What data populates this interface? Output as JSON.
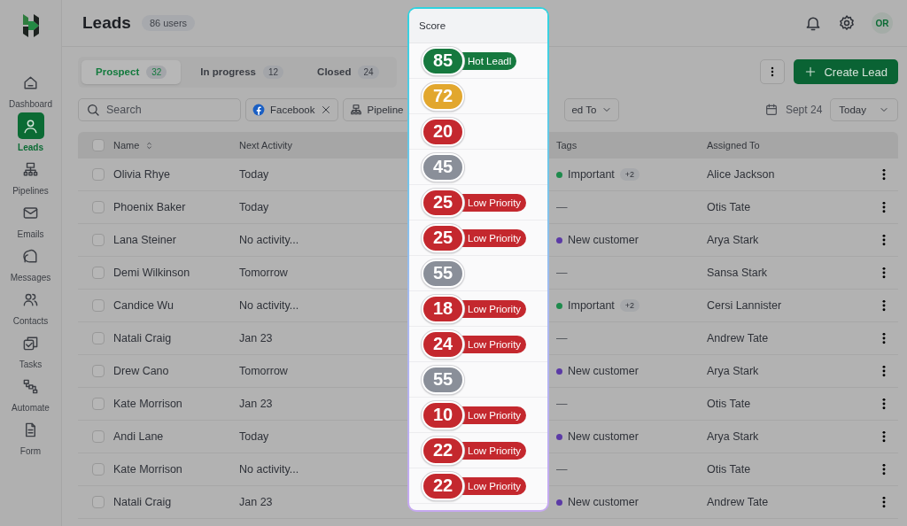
{
  "sidebar": {
    "items": [
      {
        "label": "Dashboard",
        "selected": false
      },
      {
        "label": "Leads",
        "selected": true
      },
      {
        "label": "Pipelines",
        "selected": false
      },
      {
        "label": "Emails",
        "selected": false
      },
      {
        "label": "Messages",
        "selected": false
      },
      {
        "label": "Contacts",
        "selected": false
      },
      {
        "label": "Tasks",
        "selected": false
      },
      {
        "label": "Automate",
        "selected": false
      },
      {
        "label": "Form",
        "selected": false
      }
    ]
  },
  "header": {
    "title": "Leads",
    "count": "86 users",
    "avatar": "OR"
  },
  "tabs": [
    {
      "label": "Prospect",
      "count": "32",
      "selected": true
    },
    {
      "label": "In progress",
      "count": "12",
      "selected": false
    },
    {
      "label": "Closed",
      "count": "24",
      "selected": false
    }
  ],
  "actions": {
    "create": "Create Lead"
  },
  "filters": {
    "search": {
      "placeholder": "Search"
    },
    "chips": [
      {
        "kind": "facebook",
        "label": "Facebook"
      },
      {
        "kind": "pipeline",
        "label": "Pipeline"
      },
      {
        "kind": "dropdown",
        "label": "ed To"
      }
    ],
    "date": "Sept 24",
    "range": "Today"
  },
  "table": {
    "select_all": {
      "checked": false
    },
    "columns": [
      "Name",
      "Next Activity",
      "Tags",
      "Assigned To"
    ],
    "rows": [
      {
        "checked": false,
        "name": "Olivia Rhye",
        "activity": "Today",
        "tag": {
          "kind": "dot",
          "label": "Important",
          "color": "#1e8a4c",
          "extra": "+2"
        },
        "assigned": "Alice Jackson"
      },
      {
        "checked": false,
        "name": "Phoenix Baker",
        "activity": "Today",
        "tag": {
          "kind": "empty",
          "label": "—"
        },
        "assigned": "Otis Tate"
      },
      {
        "checked": false,
        "name": "Lana Steiner",
        "activity": "No activity...",
        "tag": {
          "kind": "dot",
          "label": "New customer",
          "color": "#5b3aa6"
        },
        "assigned": "Arya Stark"
      },
      {
        "checked": false,
        "name": "Demi Wilkinson",
        "activity": "Tomorrow",
        "tag": {
          "kind": "empty",
          "label": "—"
        },
        "assigned": "Sansa Stark"
      },
      {
        "checked": false,
        "name": "Candice Wu",
        "activity": "No activity...",
        "tag": {
          "kind": "dot",
          "label": "Important",
          "color": "#1e8a4c",
          "extra": "+2"
        },
        "assigned": "Cersi Lannister"
      },
      {
        "checked": false,
        "name": "Natali Craig",
        "activity": "Jan 23",
        "tag": {
          "kind": "empty",
          "label": "—"
        },
        "assigned": "Andrew Tate"
      },
      {
        "checked": false,
        "name": "Drew Cano",
        "activity": "Tomorrow",
        "tag": {
          "kind": "dot",
          "label": "New customer",
          "color": "#5b3aa6"
        },
        "assigned": "Arya Stark"
      },
      {
        "checked": false,
        "name": "Kate Morrison",
        "activity": "Jan 23",
        "tag": {
          "kind": "empty",
          "label": "—"
        },
        "assigned": "Otis Tate"
      },
      {
        "checked": false,
        "name": "Andi Lane",
        "activity": "Today",
        "tag": {
          "kind": "dot",
          "label": "New customer",
          "color": "#5b3aa6"
        },
        "assigned": "Arya Stark"
      },
      {
        "checked": false,
        "name": "Kate Morrison",
        "activity": "No activity...",
        "tag": {
          "kind": "empty",
          "label": "—"
        },
        "assigned": "Otis Tate"
      },
      {
        "checked": false,
        "name": "Natali Craig",
        "activity": "Jan 23",
        "tag": {
          "kind": "dot",
          "label": "New customer",
          "color": "#5b3aa6"
        },
        "assigned": "Andrew Tate"
      }
    ]
  },
  "score_popover": {
    "title": "Score",
    "scores": [
      {
        "value": "85",
        "color": "#16793f",
        "label": "Hot Leadl"
      },
      {
        "value": "72",
        "color": "#e2a72e"
      },
      {
        "value": "20",
        "color": "#c4282e"
      },
      {
        "value": "45",
        "color": "#8a8f99"
      },
      {
        "value": "25",
        "color": "#c4282e",
        "label": "Low Priority"
      },
      {
        "value": "25",
        "color": "#c4282e",
        "label": "Low Priority"
      },
      {
        "value": "55",
        "color": "#8a8f99"
      },
      {
        "value": "18",
        "color": "#c4282e",
        "label": "Low Priority"
      },
      {
        "value": "24",
        "color": "#c4282e",
        "label": "Low Priority"
      },
      {
        "value": "55",
        "color": "#8a8f99"
      },
      {
        "value": "10",
        "color": "#c4282e",
        "label": "Low Priority"
      },
      {
        "value": "22",
        "color": "#c4282e",
        "label": "Low Priority"
      },
      {
        "value": "22",
        "color": "#c4282e",
        "label": "Low Priority"
      }
    ]
  }
}
